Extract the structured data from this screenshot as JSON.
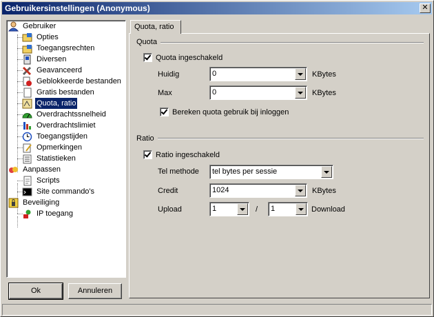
{
  "window": {
    "title": "Gebruikersinstellingen (Anonymous)",
    "close_glyph": "✕"
  },
  "tree": {
    "items": [
      {
        "label": "Gebruiker",
        "icon": "user-icon",
        "level": 0
      },
      {
        "label": "Opties",
        "icon": "options-icon",
        "level": 1
      },
      {
        "label": "Toegangsrechten",
        "icon": "folder-access-icon",
        "level": 1
      },
      {
        "label": "Diversen",
        "icon": "misc-icon",
        "level": 1
      },
      {
        "label": "Geavanceerd",
        "icon": "tools-icon",
        "level": 1
      },
      {
        "label": "Geblokkeerde bestanden",
        "icon": "blocked-file-icon",
        "level": 1
      },
      {
        "label": "Gratis bestanden",
        "icon": "file-icon",
        "level": 1
      },
      {
        "label": "Quota, ratio",
        "icon": "scale-icon",
        "level": 1,
        "selected": true
      },
      {
        "label": "Overdrachtssnelheid",
        "icon": "speed-icon",
        "level": 1
      },
      {
        "label": "Overdrachtslimiet",
        "icon": "limit-icon",
        "level": 1
      },
      {
        "label": "Toegangstijden",
        "icon": "clock-icon",
        "level": 1
      },
      {
        "label": "Opmerkingen",
        "icon": "notes-icon",
        "level": 1
      },
      {
        "label": "Statistieken",
        "icon": "stats-icon",
        "level": 1
      },
      {
        "label": "Aanpassen",
        "icon": "customize-icon",
        "level": 0
      },
      {
        "label": "Scripts",
        "icon": "script-icon",
        "level": 1
      },
      {
        "label": "Site commando's",
        "icon": "console-icon",
        "level": 1
      },
      {
        "label": "Beveiliging",
        "icon": "lock-icon",
        "level": 0
      },
      {
        "label": "IP toegang",
        "icon": "ip-icon",
        "level": 1
      }
    ]
  },
  "buttons": {
    "ok": "Ok",
    "cancel": "Annuleren"
  },
  "tab": {
    "label": "Quota, ratio"
  },
  "quota": {
    "group_label": "Quota",
    "enabled_label": "Quota ingeschakeld",
    "current_label": "Huidig",
    "current_value": "0",
    "max_label": "Max",
    "max_value": "0",
    "unit": "KBytes",
    "calc_label": "Bereken quota gebruik bij inloggen"
  },
  "ratio": {
    "group_label": "Ratio",
    "enabled_label": "Ratio ingeschakeld",
    "method_label": "Tel methode",
    "method_value": "tel bytes per sessie",
    "credit_label": "Credit",
    "credit_value": "1024",
    "unit": "KBytes",
    "upload_label": "Upload",
    "upload_value": "1",
    "separator": "/",
    "download_value": "1",
    "download_label": "Download"
  }
}
